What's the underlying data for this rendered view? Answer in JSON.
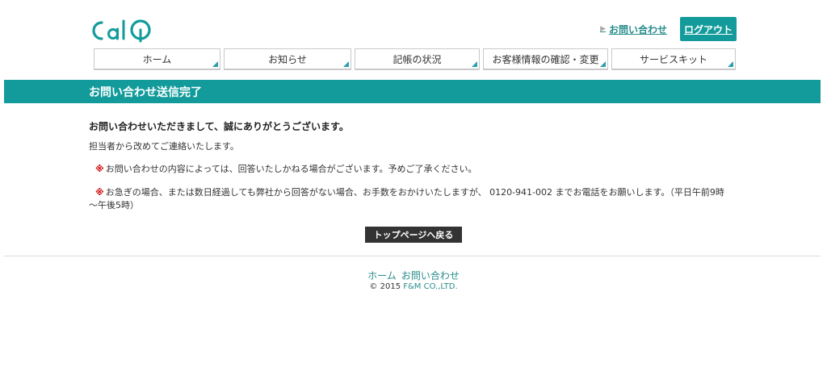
{
  "header": {
    "logo_text": "CalQ",
    "contact_label": "お問い合わせ",
    "logout_label": "ログアウト"
  },
  "nav": {
    "items": [
      {
        "label": "ホーム"
      },
      {
        "label": "お知らせ"
      },
      {
        "label": "記帳の状況"
      },
      {
        "label": "お客様情報の確認・変更"
      },
      {
        "label": "サービスキット"
      }
    ]
  },
  "page": {
    "title": "お問い合わせ送信完了",
    "heading": "お問い合わせいただきまして、誠にありがとうございます。",
    "intro": "担当者から改めてご連絡いたします。",
    "note_mark": "※",
    "note1": "お問い合わせの内容によっては、回答いたしかねる場合がございます。予めご了承ください。",
    "note2_line1": "お急ぎの場合、または数日経過しても弊社から回答がない場合、お手数をおかけいたしますが、 0120-941-002 までお電話をお願いします。（平日午前9時",
    "note2_line2": "～午後5時）",
    "back_button": "トップページへ戻る"
  },
  "footer": {
    "links": [
      {
        "label": "ホーム"
      },
      {
        "label": "お問い合わせ"
      }
    ],
    "copyright_prefix": "© 2015 ",
    "company": "F&M CO.,LTD."
  },
  "colors": {
    "brand": "#139b9b",
    "link": "#2a8c8c",
    "alert": "#cc0000"
  }
}
